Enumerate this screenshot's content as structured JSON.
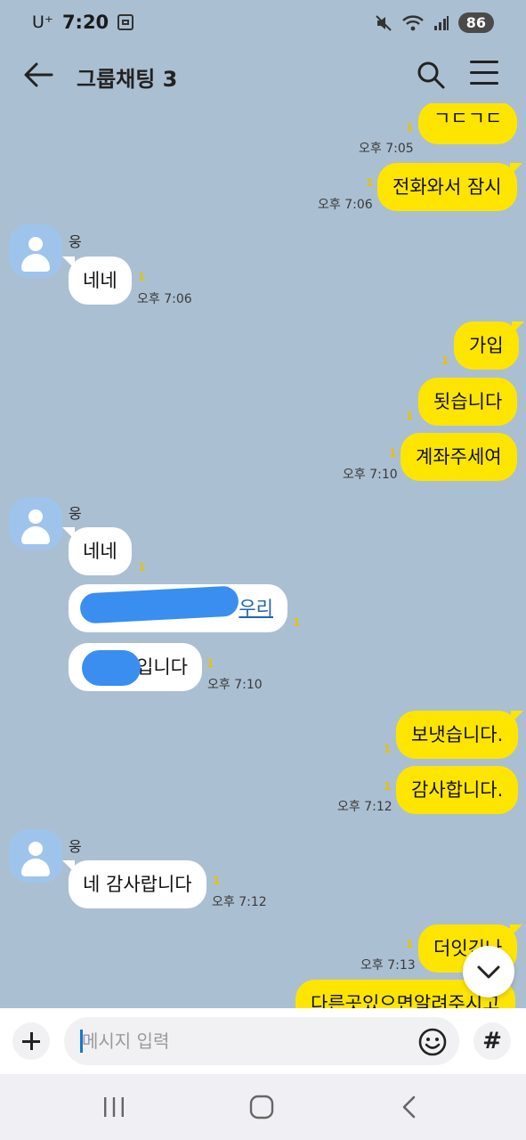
{
  "status_bar": {
    "carrier": "U⁺",
    "time": "7:20",
    "battery": "86"
  },
  "header": {
    "title": "그룹채팅 3"
  },
  "messages": {
    "m1": {
      "text": "ㄱㄷㄱㄷ",
      "unread": "1",
      "time": "오후 7:05"
    },
    "m2": {
      "text": "전화와서 잠시",
      "unread": "1",
      "time": "오후 7:06"
    },
    "m3": {
      "sender": "웅",
      "text": "네네",
      "unread": "1",
      "time": "오후 7:06"
    },
    "m4": {
      "text": "가입",
      "unread": "1"
    },
    "m5": {
      "text": "됫습니다",
      "unread": "1"
    },
    "m6": {
      "text": "계좌주세여",
      "unread": "1",
      "time": "오후 7:10"
    },
    "m7": {
      "sender": "웅",
      "text": "네네",
      "unread": "1"
    },
    "m8": {
      "text": "우리",
      "unread": "1"
    },
    "m9": {
      "text": "입니다",
      "unread": "1",
      "time": "오후 7:10"
    },
    "m10": {
      "text": "보냇습니다.",
      "unread": "1"
    },
    "m11": {
      "text": "감사합니다.",
      "unread": "1",
      "time": "오후 7:12"
    },
    "m12": {
      "sender": "웅",
      "text": "네 감사랍니다",
      "unread": "1",
      "time": "오후 7:12"
    },
    "m13": {
      "text": "더잇긴나",
      "unread": "1",
      "time": "오후 7:13"
    },
    "m14": {
      "text": "다른곳있으면알려주시고"
    }
  },
  "input": {
    "placeholder": "메시지 입력"
  },
  "icons": {
    "back": "arrow-left-icon",
    "search": "search-icon",
    "menu": "hamburger-menu-icon",
    "plus": "plus-icon",
    "emoji": "emoji-icon",
    "hash": "hash-icon",
    "scroll_down": "chevron-down-icon",
    "recents": "recents-icon",
    "home": "home-icon",
    "sys_back": "chevron-left-icon"
  },
  "colors": {
    "background": "#abbfd2",
    "my_bubble": "#fee500",
    "their_bubble": "#ffffff",
    "unread": "#e7c200",
    "avatar": "#9fc4ec"
  }
}
